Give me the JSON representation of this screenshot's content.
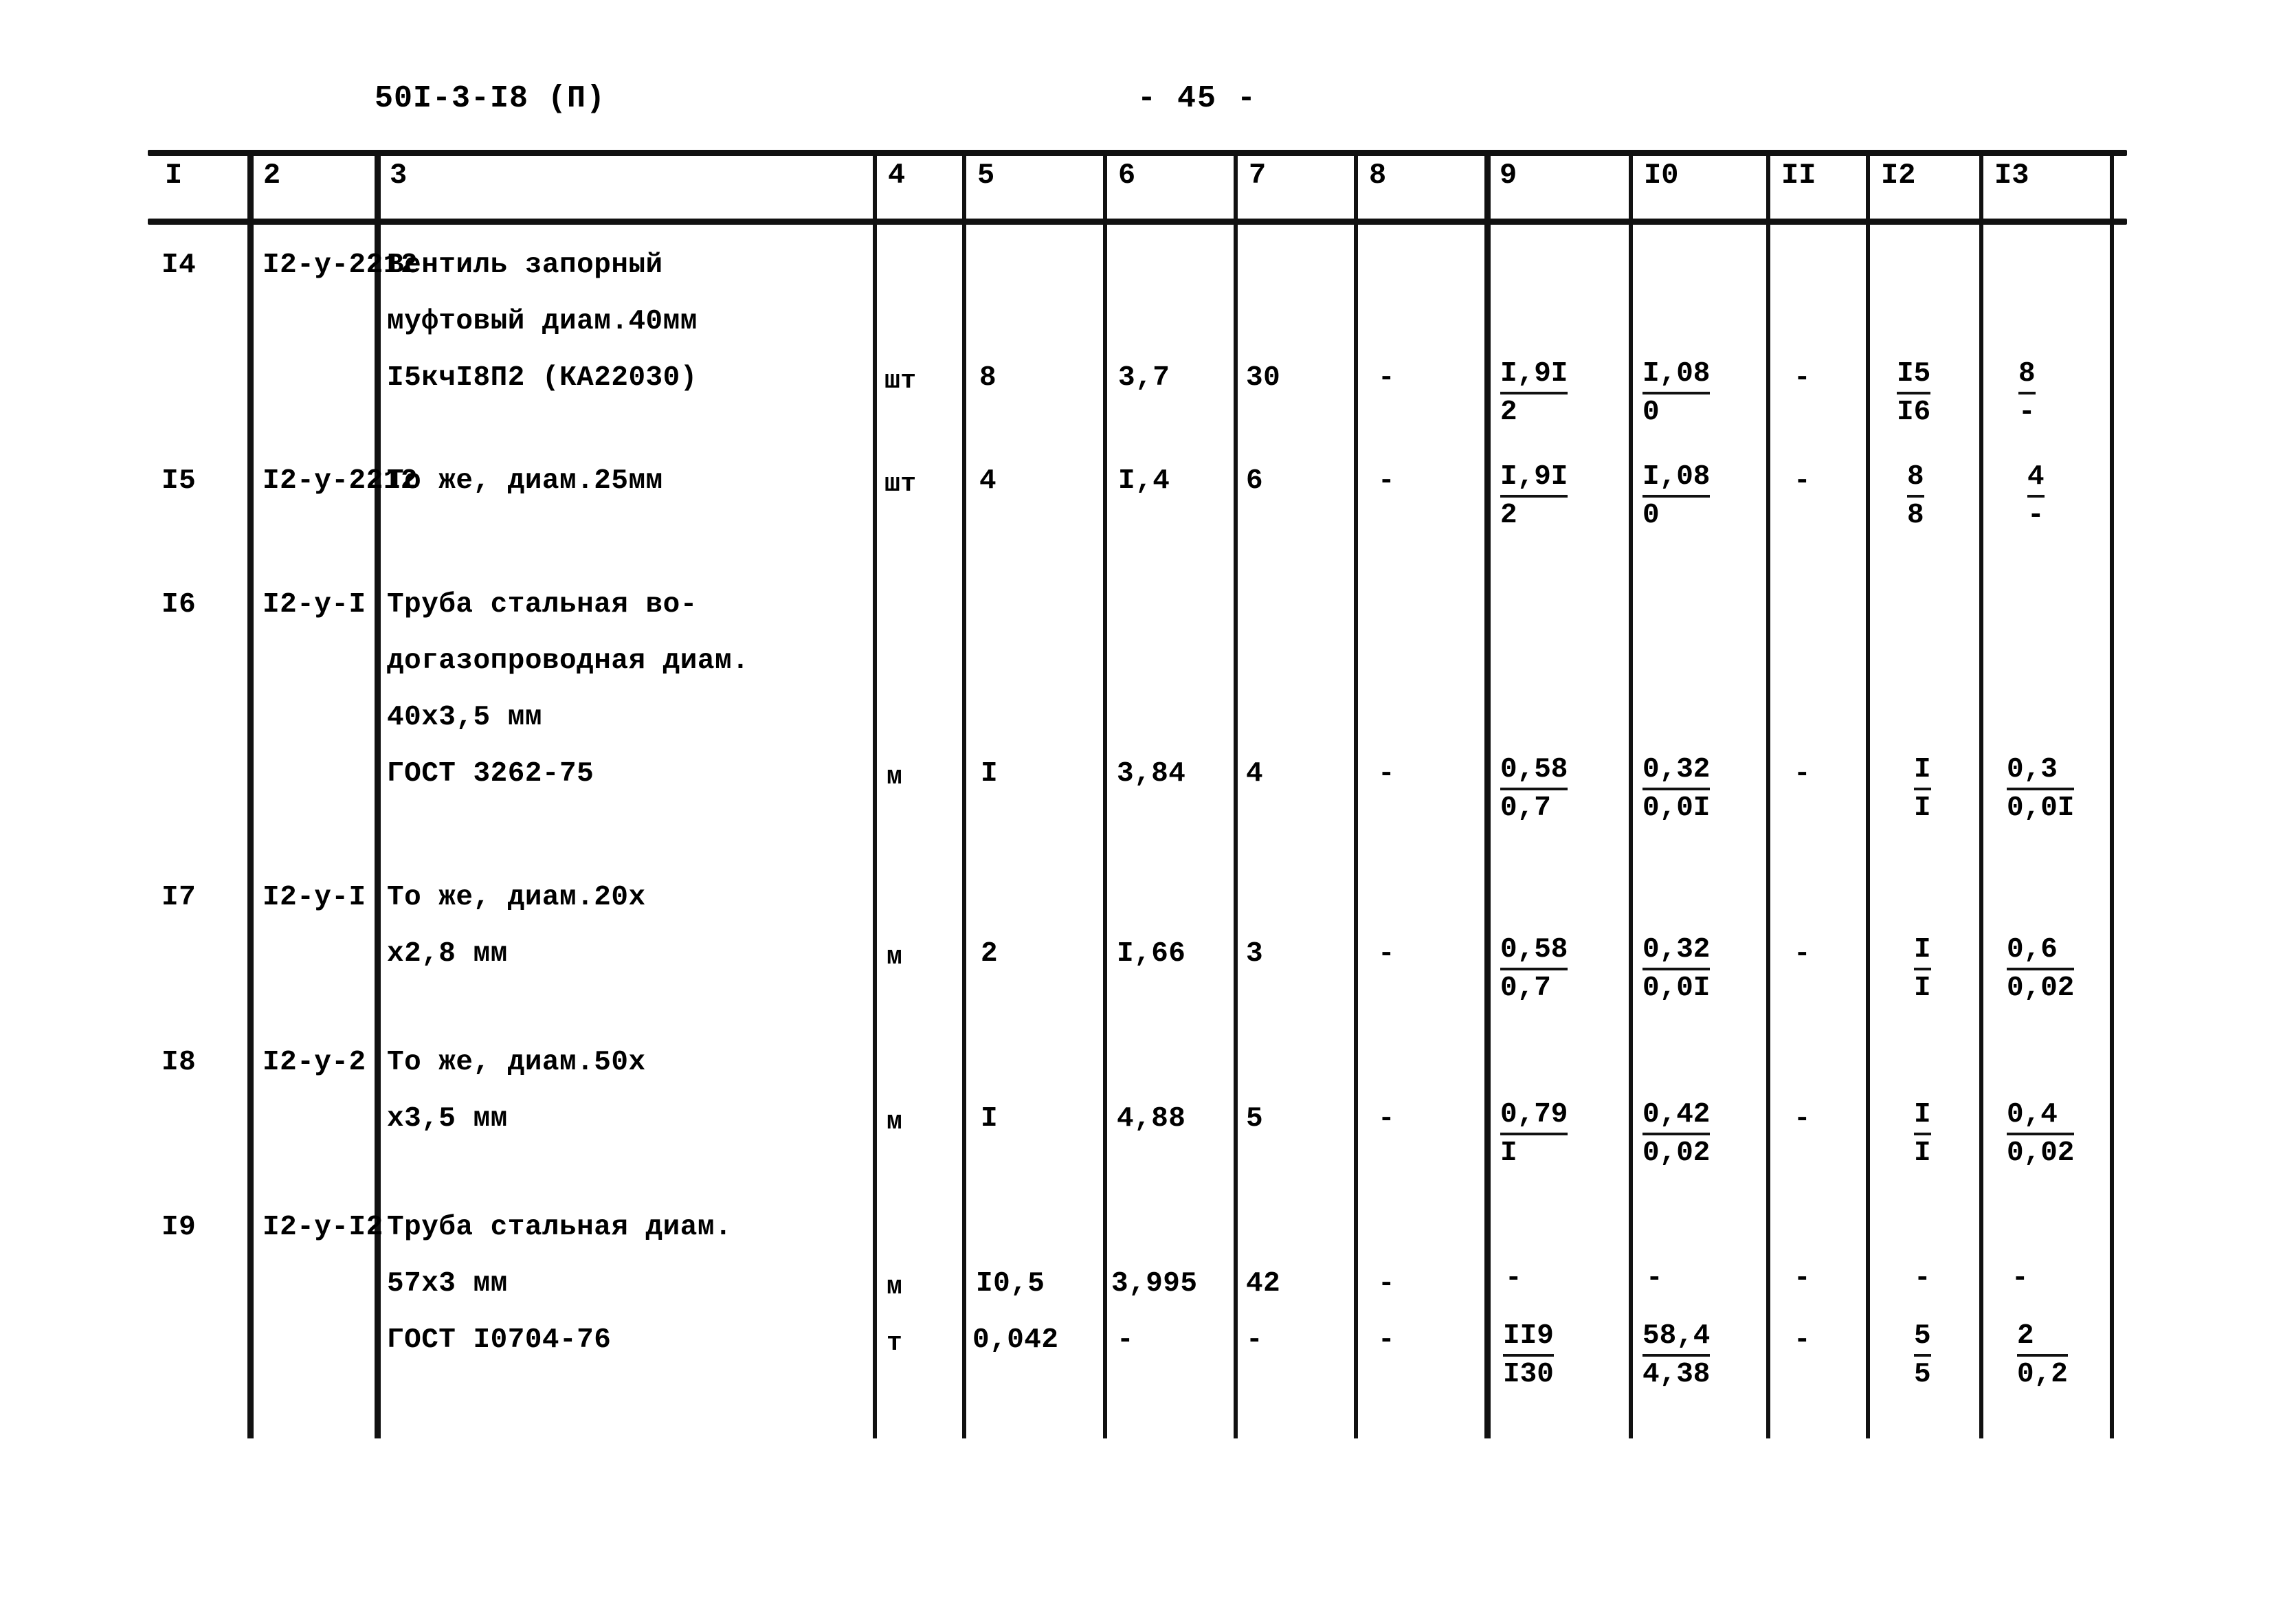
{
  "header": {
    "doc_code": "50I-3-I8 (П)",
    "page_label": "- 45 -"
  },
  "table": {
    "column_headers": [
      "I",
      "2",
      "3",
      "4",
      "5",
      "6",
      "7",
      "8",
      "9",
      "I0",
      "II",
      "I2",
      "I3"
    ],
    "rows": [
      {
        "col1": "I4",
        "col2": "I2-у-2212",
        "col3_lines": [
          "Вентиль запорный",
          "муфтовый диам.40мм",
          "I5кчI8П2 (КА22030)"
        ],
        "col4": "шт",
        "col5": "8",
        "col6": "3,7",
        "col7": "30",
        "col8": "-",
        "col9_num": "I,9I",
        "col9_den": "2",
        "col10_num": "I,08",
        "col10_den": "0",
        "col11": "-",
        "col12_num": "I5",
        "col12_den": "I6",
        "col13_num": "8",
        "col13_den": "-"
      },
      {
        "col1": "I5",
        "col2": "I2-у-2212",
        "col3_lines": [
          "То же, диам.25мм"
        ],
        "col4": "шт",
        "col5": "4",
        "col6": "I,4",
        "col7": "6",
        "col8": "-",
        "col9_num": "I,9I",
        "col9_den": "2",
        "col10_num": "I,08",
        "col10_den": "0",
        "col11": "-",
        "col12_num": "8",
        "col12_den": "8",
        "col13_num": "4",
        "col13_den": "-"
      },
      {
        "col1": "I6",
        "col2": "I2-у-I",
        "col3_lines": [
          "Труба стальная во-",
          "догазопроводная диам.",
          "40х3,5 мм",
          "ГОСТ 3262-75"
        ],
        "col4": "м",
        "col5": "I",
        "col6": "3,84",
        "col7": "4",
        "col8": "-",
        "col9_num": "0,58",
        "col9_den": "0,7",
        "col10_num": "0,32",
        "col10_den": "0,0I",
        "col11": "-",
        "col12_num": "I",
        "col12_den": "I",
        "col13_num": "0,3",
        "col13_den": "0,0I"
      },
      {
        "col1": "I7",
        "col2": "I2-у-I",
        "col3_lines": [
          "То же, диам.20х",
          "х2,8 мм"
        ],
        "col4": "м",
        "col5": "2",
        "col6": "I,66",
        "col7": "3",
        "col8": "-",
        "col9_num": "0,58",
        "col9_den": "0,7",
        "col10_num": "0,32",
        "col10_den": "0,0I",
        "col11": "-",
        "col12_num": "I",
        "col12_den": "I",
        "col13_num": "0,6",
        "col13_den": "0,02"
      },
      {
        "col1": "I8",
        "col2": "I2-у-2",
        "col3_lines": [
          "То же, диам.50х",
          "х3,5 мм"
        ],
        "col4": "м",
        "col5": "I",
        "col6": "4,88",
        "col7": "5",
        "col8": "-",
        "col9_num": "0,79",
        "col9_den": "I",
        "col10_num": "0,42",
        "col10_den": "0,02",
        "col11": "-",
        "col12_num": "I",
        "col12_den": "I",
        "col13_num": "0,4",
        "col13_den": "0,02"
      },
      {
        "col1": "I9",
        "col2": "I2-у-I2",
        "col3_lines": [
          "Труба стальная диам.",
          "57х3 мм",
          "ГОСТ I0704-76"
        ],
        "col4_a": "м",
        "col5_a": "I0,5",
        "col6_a": "3,995",
        "col7_a": "42",
        "col8_a": "-",
        "col9_a": "-",
        "col10_a": "-",
        "col11_a": "-",
        "col12_a": "-",
        "col13_a": "-",
        "col4_b": "т",
        "col5_b": "0,042",
        "col6_b": "-",
        "col7_b": "-",
        "col8_b": "-",
        "col9_num": "II9",
        "col9_den": "I30",
        "col10_num": "58,4",
        "col10_den": "4,38",
        "col11_b": "-",
        "col12_num": "5",
        "col12_den": "5",
        "col13_num": "2",
        "col13_den": "0,2"
      }
    ]
  }
}
